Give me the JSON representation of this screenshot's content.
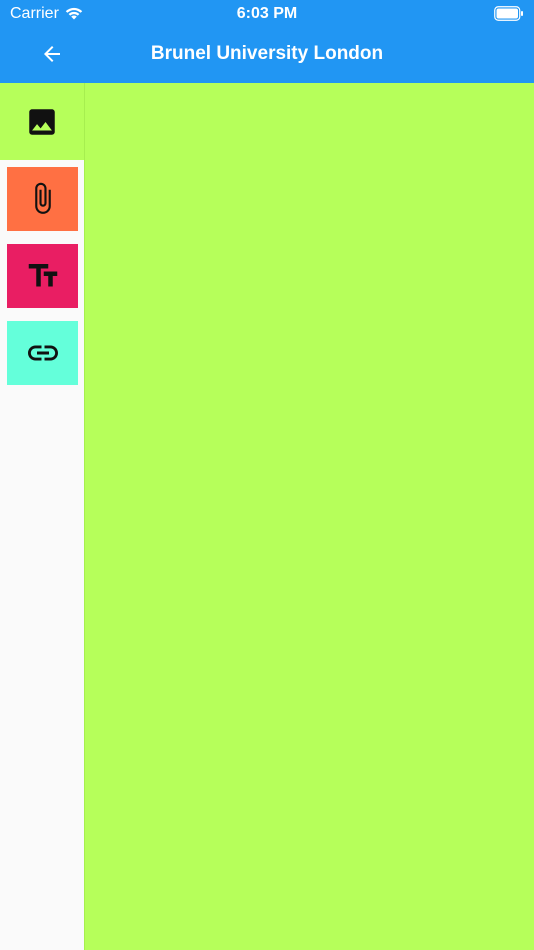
{
  "status_bar": {
    "carrier": "Carrier",
    "time": "6:03 PM",
    "icons": [
      "wifi-icon",
      "battery-icon"
    ]
  },
  "header": {
    "title": "Brunel University London",
    "back_icon": "arrow-left-icon"
  },
  "sidebar": {
    "items": [
      {
        "name": "image",
        "icon": "image-icon",
        "color": "#b6ff5a"
      },
      {
        "name": "attachment",
        "icon": "paperclip-icon",
        "color": "#ff7043"
      },
      {
        "name": "text-size",
        "icon": "text-fields-icon",
        "color": "#e91e63"
      },
      {
        "name": "link",
        "icon": "link-icon",
        "color": "#64ffda"
      }
    ]
  },
  "colors": {
    "header": "#2196f3",
    "canvas": "#b6ff5a",
    "sidebar": "#fafafa"
  }
}
